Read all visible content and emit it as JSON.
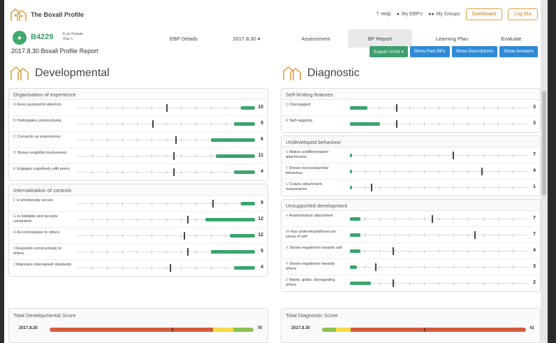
{
  "app": {
    "title": "The Boxall Profile"
  },
  "toplinks": {
    "help": "Help",
    "my_ebps": "My EBP's",
    "my_groups": "My Groups"
  },
  "topbuttons": {
    "dashboard": "Dashboard",
    "logout": "Log Out"
  },
  "student": {
    "id": "B4229",
    "age_gender": "8 y/o Female",
    "year": "Year 1"
  },
  "nav": {
    "ebp_details": "EBP Details",
    "date_select": "2017.8.30 ▾",
    "assessment": "Assessment",
    "bp_report": "BP Report",
    "learning_plan": "Learning Plan",
    "evaluate": "Evaluate"
  },
  "page": {
    "title": "2017.8.30 Boxall Profile Report"
  },
  "actions": {
    "export": "Export / Print ▾",
    "past": "Show Past BPs",
    "descriptions": "Show Descriptions",
    "answers": "Show Answers"
  },
  "colors": {
    "fill": "#3aa46d",
    "accent": "#e0a242",
    "bar_red": "#d45c3c",
    "bar_yellow": "#f3dd45",
    "bar_green": "#8cc152"
  },
  "developmental": {
    "title": "Developmental",
    "sections": [
      {
        "title": "Organisation of experience",
        "rows": [
          {
            "code": "A",
            "label": "Gives purposeful attention",
            "score": "10",
            "fill_end": 0.92,
            "mark": 0.5
          },
          {
            "code": "B",
            "label": "Participates constructively",
            "score": "5",
            "fill_end": 0.88,
            "mark": 0.42
          },
          {
            "code": "C",
            "label": "Connects up experiences",
            "score": "6",
            "fill_end": 0.75,
            "mark": 0.55
          },
          {
            "code": "D",
            "label": "Shows insightful involvement",
            "score": "11",
            "fill_end": 0.78,
            "mark": 0.54
          },
          {
            "code": "E",
            "label": "Engages cognitively with peers",
            "score": "4",
            "fill_end": 0.88,
            "mark": 0.54
          }
        ]
      },
      {
        "title": "Internalisation of controls",
        "rows": [
          {
            "code": "F",
            "label": "Is emotionally secure",
            "score": "9",
            "fill_end": 0.92,
            "mark": 0.76
          },
          {
            "code": "G",
            "label": "Is biddable and accepts constraints",
            "score": "12",
            "fill_end": 0.72,
            "mark": 0.62
          },
          {
            "code": "H",
            "label": "Accommodates to others",
            "score": "12",
            "fill_end": 0.86,
            "mark": 0.6
          },
          {
            "code": "I",
            "label": "Responds constructively to others",
            "score": "5",
            "fill_end": 0.75,
            "mark": 0.62
          },
          {
            "code": "J",
            "label": "Maintains internalised standards",
            "score": "4",
            "fill_end": 0.88,
            "mark": 0.52
          }
        ]
      }
    ],
    "total": {
      "title": "Total Developmental Score",
      "date": "2017.8.30",
      "score": "78"
    }
  },
  "diagnostic": {
    "title": "Diagnostic",
    "sections": [
      {
        "title": "Self-limiting features",
        "rows": [
          {
            "code": "Q",
            "label": "Disengaged",
            "score": "3",
            "fill_end": 0.1,
            "mark": 0.26
          },
          {
            "code": "R",
            "label": "Self-negating",
            "score": "3",
            "fill_end": 0.17,
            "mark": 0.26
          }
        ]
      },
      {
        "title": "Undeveloped behaviour",
        "rows": [
          {
            "code": "S",
            "label": "Makes undifferentiated attachments",
            "score": "7",
            "fill_end": 0.0,
            "mark": 0.58
          },
          {
            "code": "T",
            "label": "Shows inconsequential behaviour",
            "score": "4",
            "fill_end": 0.0,
            "mark": 0.74
          },
          {
            "code": "U",
            "label": "Craves attachment, reassurance",
            "score": "1",
            "fill_end": 0.0,
            "mark": 0.12
          }
        ]
      },
      {
        "title": "Unsupported development",
        "rows": [
          {
            "code": "V",
            "label": "Avoids/rejects attachment",
            "score": "7",
            "fill_end": 0.06,
            "mark": 0.46
          },
          {
            "code": "W",
            "label": "Has undeveloped/insecure sense of self",
            "score": "7",
            "fill_end": 0.06,
            "mark": 0.7
          },
          {
            "code": "X",
            "label": "Shows negativism towards self",
            "score": "4",
            "fill_end": 0.06,
            "mark": 0.24
          },
          {
            "code": "Y",
            "label": "Shows negativism towards others",
            "score": "3",
            "fill_end": 0.04,
            "mark": 0.14
          },
          {
            "code": "Z",
            "label": "Wants, grabs, disregarding others",
            "score": "2",
            "fill_end": 0.12,
            "mark": 0.24
          }
        ]
      }
    ],
    "total": {
      "title": "Total Diagnostic Score",
      "date": "2017.8.30",
      "score": "41"
    }
  },
  "totals": {
    "developmental_segments": [
      {
        "color": "#d45c3c",
        "frac": 0.8
      },
      {
        "color": "#f3dd45",
        "frac": 0.1
      },
      {
        "color": "#8cc152",
        "frac": 0.1
      }
    ],
    "diagnostic_segments": [
      {
        "color": "#8cc152",
        "frac": 0.07
      },
      {
        "color": "#f3dd45",
        "frac": 0.07
      },
      {
        "color": "#d45c3c",
        "frac": 0.86
      }
    ],
    "developmental_mark": 0.6,
    "diagnostic_mark": 0.5
  }
}
